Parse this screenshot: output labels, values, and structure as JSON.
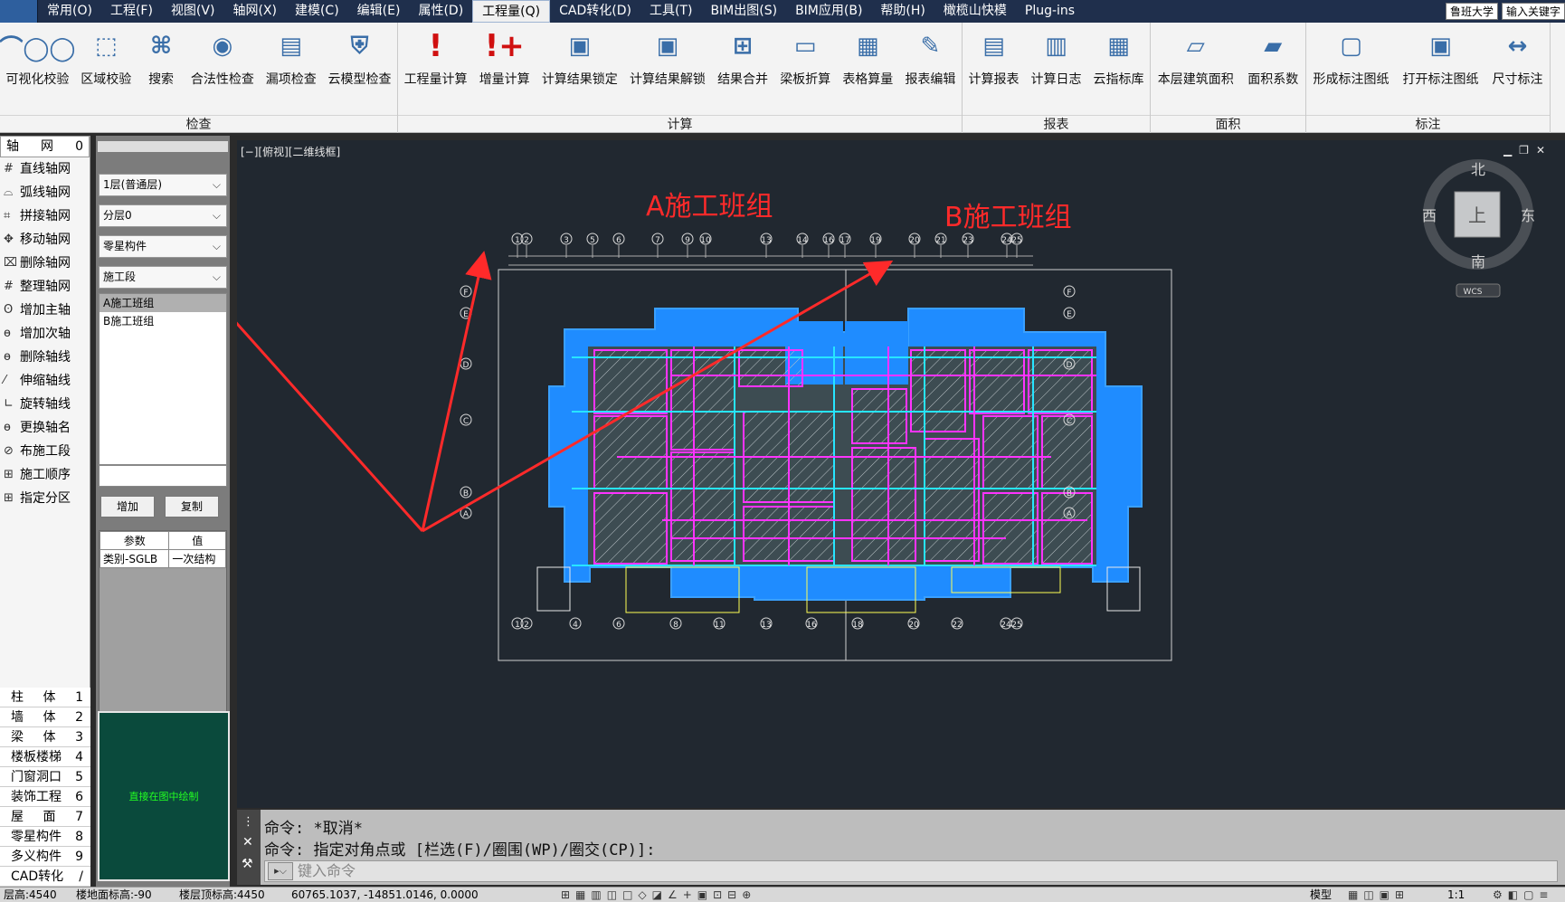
{
  "menubar": {
    "items": [
      "常用(O)",
      "工程(F)",
      "视图(V)",
      "轴网(X)",
      "建模(C)",
      "编辑(E)",
      "属性(D)",
      "工程量(Q)",
      "CAD转化(D)",
      "工具(T)",
      "BIM出图(S)",
      "BIM应用(B)",
      "帮助(H)",
      "橄榄山快模",
      "Plug-ins"
    ],
    "active_index": 7,
    "user": "鲁班大学",
    "search_placeholder": "输入关键字"
  },
  "ribbon": {
    "groups": [
      {
        "title": "检查",
        "buttons": [
          {
            "label": "可视化校验",
            "icon": "glasses-icon"
          },
          {
            "label": "区域校验",
            "icon": "region-check-icon"
          },
          {
            "label": "搜索",
            "icon": "binoculars-icon"
          },
          {
            "label": "合法性检查",
            "icon": "legality-check-icon"
          },
          {
            "label": "漏项检查",
            "icon": "missing-item-icon"
          },
          {
            "label": "云模型检查",
            "icon": "cloud-model-icon"
          }
        ]
      },
      {
        "title": "计算",
        "buttons": [
          {
            "label": "工程量计算",
            "icon": "calc-exclaim-icon"
          },
          {
            "label": "增量计算",
            "icon": "increment-calc-icon"
          },
          {
            "label": "计算结果锁定",
            "icon": "result-lock-icon"
          },
          {
            "label": "计算结果解锁",
            "icon": "result-unlock-icon"
          },
          {
            "label": "结果合并",
            "icon": "merge-icon"
          },
          {
            "label": "梁板折算",
            "icon": "beam-slab-icon"
          },
          {
            "label": "表格算量",
            "icon": "table-calc-icon"
          },
          {
            "label": "报表编辑",
            "icon": "report-edit-icon"
          }
        ]
      },
      {
        "title": "报表",
        "buttons": [
          {
            "label": "计算报表",
            "icon": "calc-report-icon"
          },
          {
            "label": "计算日志",
            "icon": "calc-log-icon"
          },
          {
            "label": "云指标库",
            "icon": "cloud-index-icon"
          }
        ]
      },
      {
        "title": "面积",
        "buttons": [
          {
            "label": "本层建筑面积",
            "icon": "floor-area-icon"
          },
          {
            "label": "面积系数",
            "icon": "area-coef-icon"
          }
        ]
      },
      {
        "title": "标注",
        "buttons": [
          {
            "label": "形成标注图纸",
            "icon": "form-drawing-icon"
          },
          {
            "label": "打开标注图纸",
            "icon": "open-drawing-icon"
          },
          {
            "label": "尺寸标注",
            "icon": "dimension-icon"
          }
        ]
      }
    ]
  },
  "left_toolbar": {
    "header": {
      "label": "轴",
      "label2": "网",
      "num": "0"
    },
    "items": [
      {
        "label": "直线轴网",
        "icon": "straight-grid-icon"
      },
      {
        "label": "弧线轴网",
        "icon": "arc-grid-icon"
      },
      {
        "label": "拼接轴网",
        "icon": "splice-grid-icon"
      },
      {
        "label": "移动轴网",
        "icon": "move-grid-icon"
      },
      {
        "label": "删除轴网",
        "icon": "delete-grid-icon"
      },
      {
        "label": "整理轴网",
        "icon": "arrange-grid-icon"
      },
      {
        "label": "增加主轴",
        "icon": "add-main-axis-icon"
      },
      {
        "label": "增加次轴",
        "icon": "add-sub-axis-icon"
      },
      {
        "label": "删除轴线",
        "icon": "delete-axis-icon"
      },
      {
        "label": "伸缩轴线",
        "icon": "stretch-axis-icon"
      },
      {
        "label": "旋转轴线",
        "icon": "rotate-axis-icon"
      },
      {
        "label": "更换轴名",
        "icon": "rename-axis-icon"
      },
      {
        "label": "布施工段",
        "icon": "place-segment-icon"
      },
      {
        "label": "施工顺序",
        "icon": "construction-order-icon"
      },
      {
        "label": "指定分区",
        "icon": "assign-zone-icon"
      }
    ],
    "categories": [
      {
        "label": "柱",
        "label2": "体",
        "num": "1"
      },
      {
        "label": "墙",
        "label2": "体",
        "num": "2"
      },
      {
        "label": "梁",
        "label2": "体",
        "num": "3"
      },
      {
        "label": "楼板楼梯",
        "label2": "",
        "num": "4"
      },
      {
        "label": "门窗洞口",
        "label2": "",
        "num": "5"
      },
      {
        "label": "装饰工程",
        "label2": "",
        "num": "6"
      },
      {
        "label": "屋",
        "label2": "面",
        "num": "7"
      },
      {
        "label": "零星构件",
        "label2": "",
        "num": "8"
      },
      {
        "label": "多义构件",
        "label2": "",
        "num": "9"
      },
      {
        "label": "CAD转化",
        "label2": "",
        "num": "/"
      }
    ]
  },
  "property_panel": {
    "floor": "1层(普通层)",
    "layer": "分层0",
    "component": "零星构件",
    "category": "施工段",
    "groups": [
      "A施工班组",
      "B施工班组"
    ],
    "selected_group": 0,
    "add_button": "增加",
    "copy_button": "复制",
    "table": {
      "headers": [
        "参数",
        "值"
      ],
      "rows": [
        [
          "类别-SGLB",
          "一次结构"
        ]
      ]
    },
    "preview_text": "直接在图中绘制"
  },
  "viewport": {
    "label": "[−][俯视][二维线框]",
    "annotation_a": "A施工班组",
    "annotation_b": "B施工班组",
    "compass": {
      "north": "北",
      "south": "南",
      "east": "东",
      "west": "西",
      "top": "上",
      "wcs": "WCS"
    },
    "axis_top": [
      "1",
      "2",
      "3",
      "5",
      "6",
      "7",
      "9",
      "10",
      "13",
      "14",
      "16",
      "17",
      "19",
      "20",
      "21",
      "23",
      "24",
      "25"
    ],
    "axis_bottom": [
      "1",
      "2",
      "4",
      "6",
      "8",
      "11",
      "13",
      "16",
      "18",
      "20",
      "22",
      "24",
      "25"
    ],
    "axis_side": [
      "F",
      "E",
      "D",
      "C",
      "B",
      "A"
    ],
    "annotation_color": "#ff2a2a"
  },
  "command": {
    "line1": "命令: *取消*",
    "line2": "命令: 指定对角点或 [栏选(F)/圈围(WP)/圈交(CP)]:",
    "placeholder": "键入命令"
  },
  "statusbar": {
    "floor_height": "层高:4540",
    "ground_elev": "楼地面标高:-90",
    "top_elev": "楼层顶标高:4450",
    "coords": "60765.1037,  -14851.0146, 0.0000",
    "model": "模型",
    "scale": "1:1"
  }
}
